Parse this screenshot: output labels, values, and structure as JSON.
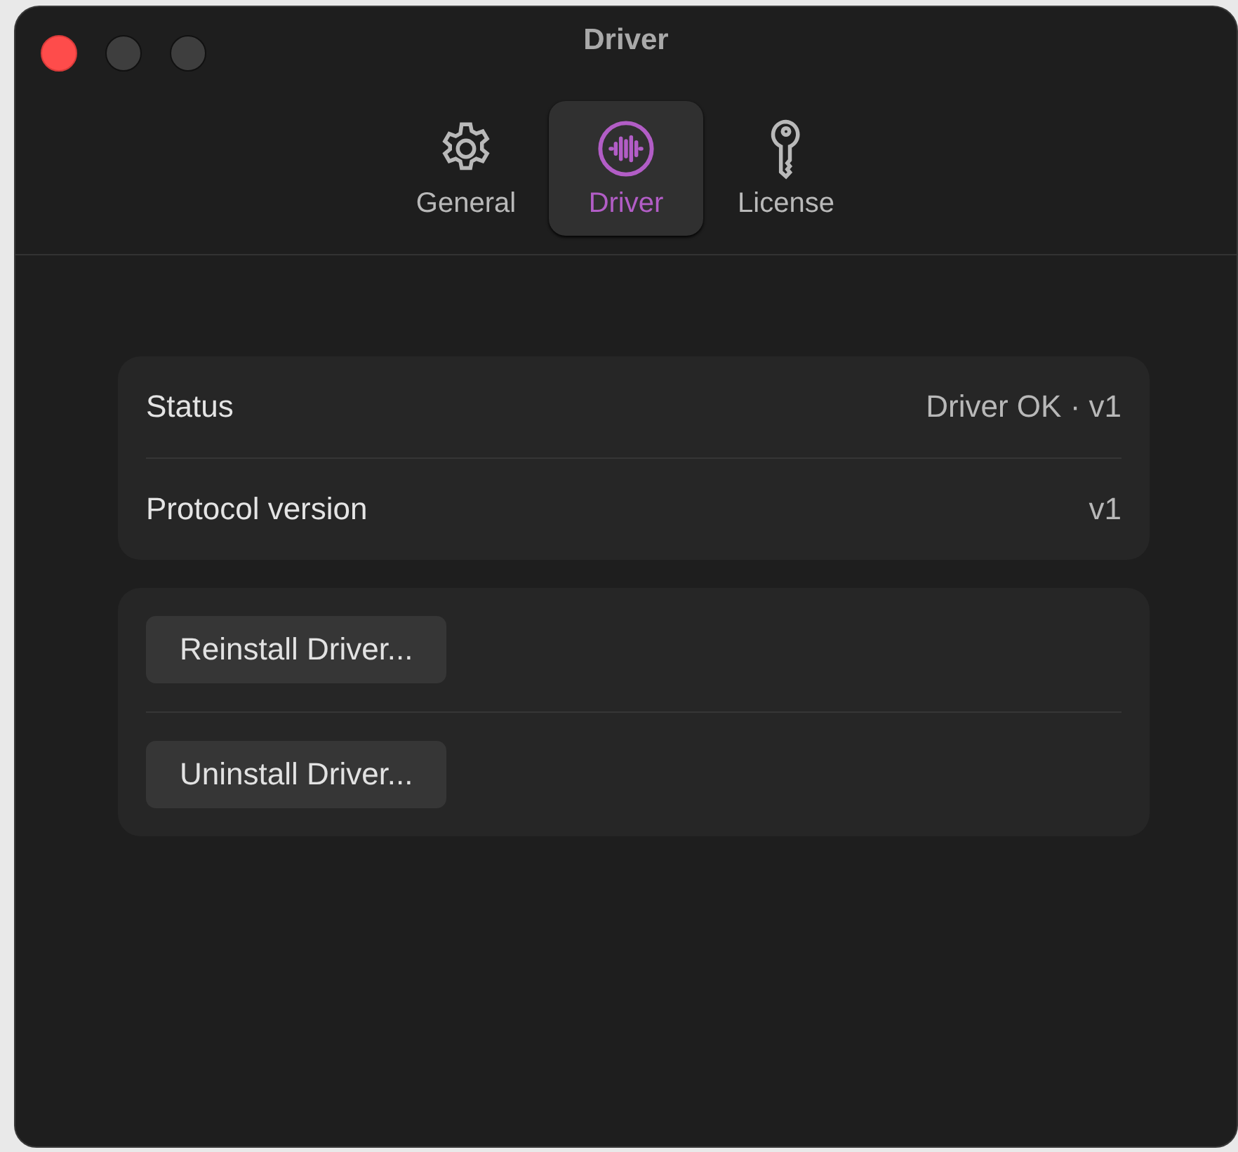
{
  "window": {
    "title": "Driver"
  },
  "tabs": [
    {
      "label": "General",
      "kind": "gear",
      "selected": false
    },
    {
      "label": "Driver",
      "kind": "driver",
      "selected": true
    },
    {
      "label": "License",
      "kind": "key",
      "selected": false
    }
  ],
  "info_rows": [
    {
      "label": "Status",
      "value": "Driver OK · v1"
    },
    {
      "label": "Protocol version",
      "value": "v1"
    }
  ],
  "actions": [
    "Reinstall Driver...",
    "Uninstall Driver..."
  ]
}
